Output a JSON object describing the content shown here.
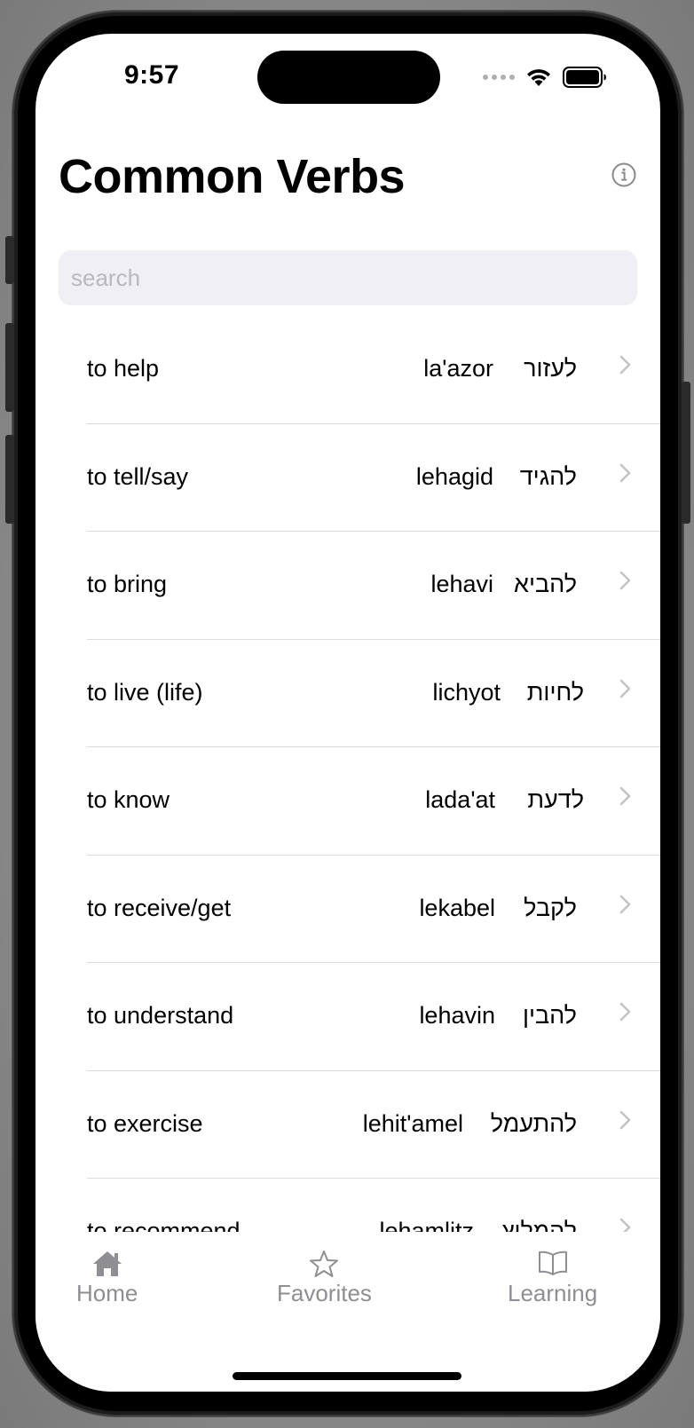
{
  "status_bar": {
    "time": "9:57"
  },
  "header": {
    "title": "Common Verbs",
    "info_icon": "info-circle-icon"
  },
  "search": {
    "placeholder": "search",
    "value": ""
  },
  "verbs": [
    {
      "english": "to help",
      "transliteration": "la'azor",
      "hebrew": "לעזור"
    },
    {
      "english": "to tell/say",
      "transliteration": "lehagid",
      "hebrew": "להגיד"
    },
    {
      "english": "to bring",
      "transliteration": "lehavi",
      "hebrew": "להביא"
    },
    {
      "english": "to live (life)",
      "transliteration": "lichyot",
      "hebrew": "לחיות"
    },
    {
      "english": "to know",
      "transliteration": "lada'at",
      "hebrew": "לדעת"
    },
    {
      "english": "to receive/get",
      "transliteration": "lekabel",
      "hebrew": "לקבל"
    },
    {
      "english": "to understand",
      "transliteration": "lehavin",
      "hebrew": "להבין"
    },
    {
      "english": "to exercise",
      "transliteration": "lehit'amel",
      "hebrew": "להתעמל"
    },
    {
      "english": "to recommend",
      "transliteration": "lehamlitz",
      "hebrew": "להמליץ"
    }
  ],
  "tab_bar": {
    "tabs": [
      {
        "label": "Home",
        "icon": "house-icon"
      },
      {
        "label": "Favorites",
        "icon": "star-icon"
      },
      {
        "label": "Learning",
        "icon": "book-icon"
      }
    ]
  },
  "colors": {
    "background": "#ffffff",
    "search_fill": "#efeff4",
    "tab_inactive": "#8e8e93",
    "divider": "#dcdcdc"
  }
}
